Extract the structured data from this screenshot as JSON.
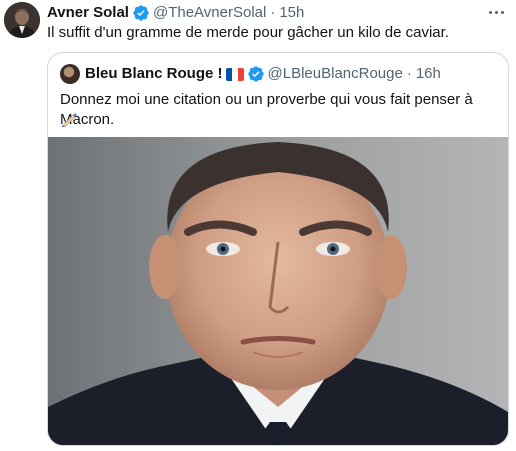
{
  "tweet": {
    "author_name": "Avner Solal",
    "handle": "@TheAvnerSolal",
    "separator": "·",
    "time": "15h",
    "text": "Il suffit d'un gramme de merde pour gâcher un kilo de caviar.",
    "more_icon": "more-horizontal-icon",
    "verified_icon": "verified-badge-icon"
  },
  "quoted_tweet": {
    "author_name": "Bleu Blanc Rouge !",
    "flag_icon": "france-flag-icon",
    "handle": "@LBleuBlancRouge",
    "separator": "·",
    "time": "16h",
    "text": "Donnez moi une citation ou un proverbe qui vous fait penser à Macron.",
    "emoji_icon": "writing-hand-emoji-icon",
    "image_icon": "portrait-photo"
  },
  "colors": {
    "verified_blue": "#1d9bf0",
    "text": "#0f1419",
    "muted": "#536471",
    "border": "#cfd9de",
    "flag_blue": "#0055a4",
    "flag_white": "#ffffff",
    "flag_red": "#ef4135"
  }
}
